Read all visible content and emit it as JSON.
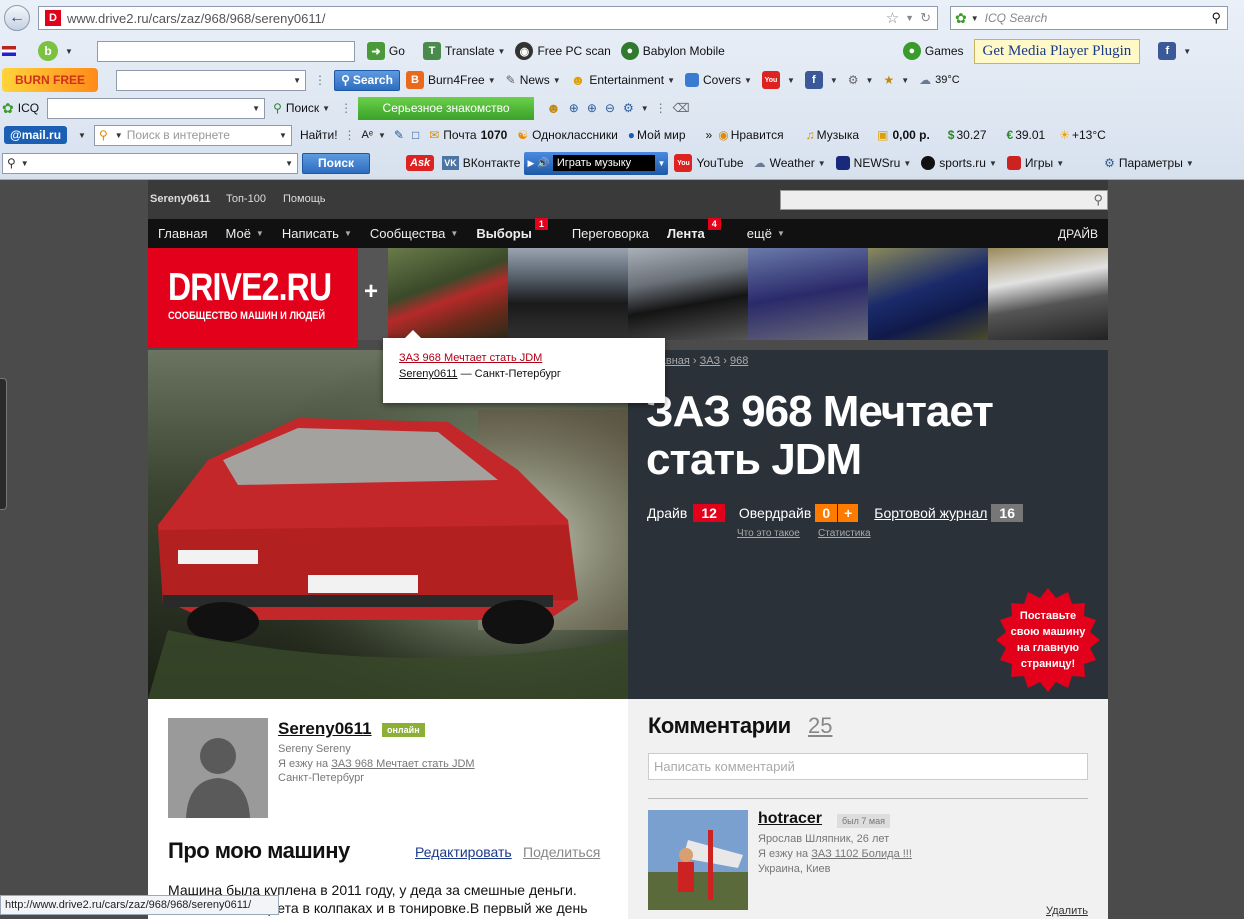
{
  "browser": {
    "url": "www.drive2.ru/cars/zaz/968/968/sereny0611/",
    "search_placeholder": "ICQ Search",
    "status_url": "http://www.drive2.ru/cars/zaz/968/968/sereny0611/"
  },
  "toolbar1": {
    "go": "Go",
    "translate": "Translate",
    "free_pc_scan": "Free PC scan",
    "babylon": "Babylon Mobile",
    "games": "Games",
    "media_plugin": "Get Media Player Plugin"
  },
  "toolbar2": {
    "logo": "BURN FREE",
    "search": "Search",
    "burn4free": "Burn4Free",
    "news": "News",
    "entertainment": "Entertainment",
    "covers": "Covers",
    "weather": "39°C"
  },
  "toolbar3": {
    "icq": "ICQ",
    "poisk": "Поиск",
    "dating": "Серьезное знакомство"
  },
  "toolbar4": {
    "mail_logo": "@mail.ru",
    "search_placeholder": "Поиск в интернете",
    "find": "Найти!",
    "mail_label": "Почта",
    "mail_count": "1070",
    "odnoklassniki": "Одноклассники",
    "moy_mir": "Мой мир",
    "nravitsya": "Нравится",
    "music": "Музыка",
    "money": "0,00 р.",
    "usd": "30.27",
    "eur": "39.01",
    "temp": "+13°C"
  },
  "toolbar5": {
    "search_btn": "Поиск",
    "vkontakte": "ВКонтакте",
    "play_music": "Играть музыку",
    "youtube": "YouTube",
    "weather": "Weather",
    "newsru": "NEWSru",
    "sports": "sports.ru",
    "games": "Игры",
    "params": "Параметры"
  },
  "site": {
    "topbar": {
      "user": "Sereny0611",
      "top100": "Топ-100",
      "help": "Помощь"
    },
    "nav": {
      "home": "Главная",
      "mine": "Моё",
      "write": "Написать",
      "communities": "Сообщества",
      "elections": "Выборы",
      "elections_badge": "1",
      "talk": "Переговорка",
      "feed": "Лента",
      "feed_badge": "4",
      "more": "ещё",
      "drive": "ДРАЙВ"
    },
    "logo": {
      "title": "DRIVE2.RU",
      "subtitle": "СООБЩЕСТВО МАШИН И ЛЮДЕЙ",
      "plus": "+"
    },
    "tooltip": {
      "title": "ЗАЗ 968 Мечтает стать JDM",
      "user": "Sereny0611",
      "city": "— Санкт-Петербург"
    },
    "breadcrumb": [
      "Главная",
      "ЗАЗ",
      "968"
    ],
    "car_title_line1": "ЗАЗ 968 Мечтает",
    "car_title_line2": "стать JDM",
    "stats": {
      "drive": "Драйв",
      "drive_count": "12",
      "overdrive": "Овердрайв",
      "overdrive_count": "0",
      "overdrive_plus": "+",
      "journal": "Бортовой журнал",
      "journal_count": "16",
      "what_is": "Что это такое",
      "statistics": "Статистика"
    },
    "promo": [
      "Поставьте",
      "свою машину",
      "на главную",
      "страницу!"
    ],
    "owner": {
      "username": "Sereny0611",
      "status": "онлайн",
      "realname": "Sereny Sereny",
      "drives_prefix": "Я езжу на",
      "drives_car": "ЗАЗ 968 Мечтает стать JDM",
      "city": "Санкт-Петербург"
    },
    "about": {
      "heading": "Про мою машину",
      "edit": "Редактировать",
      "share": "Поделиться",
      "line1": "Машина была куплена в 2011 году, у деда за смешные деньги.",
      "line2": "цвета в колпаках и в тонировке.В первый же день"
    },
    "comments": {
      "heading": "Комментарии",
      "count": "25",
      "placeholder": "Написать комментарий",
      "first": {
        "user": "hotracer",
        "seen": "был 7 мая",
        "info": "Ярослав Шляпник, 26 лет",
        "drives_prefix": "Я езжу на",
        "drives_car": "ЗАЗ 1102 Болида !!!",
        "city": "Украина, Киев",
        "delete": "Удалить"
      }
    }
  },
  "colors": {
    "brand_red": "#e2001a",
    "orange": "#ff7b00",
    "nav_bg": "#111111"
  }
}
